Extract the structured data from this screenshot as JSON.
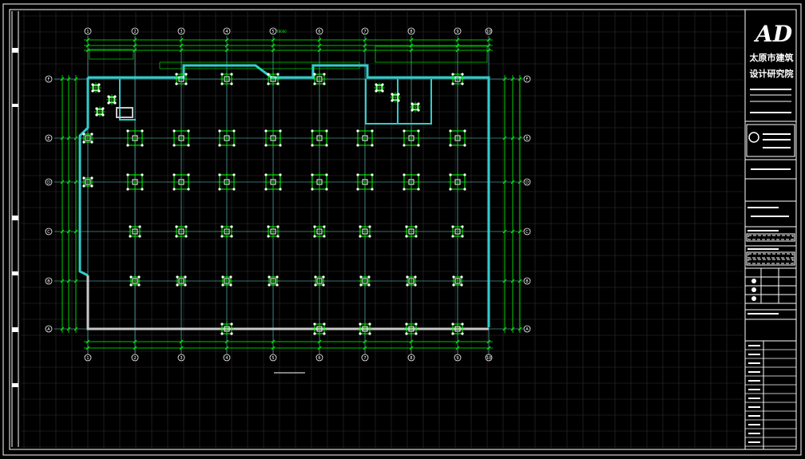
{
  "drawing": {
    "title": "",
    "columns": [
      "1",
      "2",
      "3",
      "4",
      "5",
      "6",
      "7",
      "8",
      "9",
      "10"
    ],
    "rows": [
      "F",
      "E",
      "D",
      "C",
      "B",
      "A"
    ],
    "overall_dimension": "78000",
    "colors": {
      "background": "#000000",
      "frame": "#ffffff",
      "grid": "#2e2e2e",
      "axis": "#6fd8d8",
      "dimension": "#00ff00",
      "wall": "#33cccc",
      "footing": "#ffffff"
    }
  },
  "title_block": {
    "logo_text": "AD",
    "firm_line1": "太原市建筑",
    "firm_line2": "设计研究院"
  }
}
